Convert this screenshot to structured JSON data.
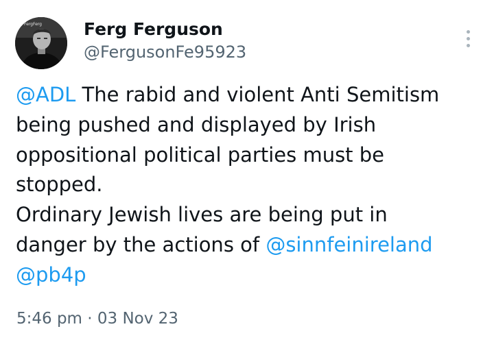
{
  "author": {
    "display_name": "Ferg Ferguson",
    "handle": "@FergusonFe95923",
    "avatar_text": "FergFerg"
  },
  "menu": {
    "icon": "more-vertical-icon"
  },
  "tweet": {
    "line1_mention": "@ADL",
    "line1_text": " The rabid and violent Anti Semitism",
    "line2": "being pushed and displayed by Irish",
    "line3": "oppositional political parties must be",
    "line4": "stopped.",
    "line5": "Ordinary Jewish lives are being put in",
    "line6_text": "danger by the actions of ",
    "line6_mention": "@sinnfeinireland",
    "line7_mention": "@pb4p"
  },
  "meta": {
    "timestamp": "5:46 pm · 03 Nov 23"
  },
  "colors": {
    "link": "#1d9bf0",
    "text": "#0f1419",
    "secondary": "#536471",
    "menu_dots": "#a9b4bc"
  }
}
